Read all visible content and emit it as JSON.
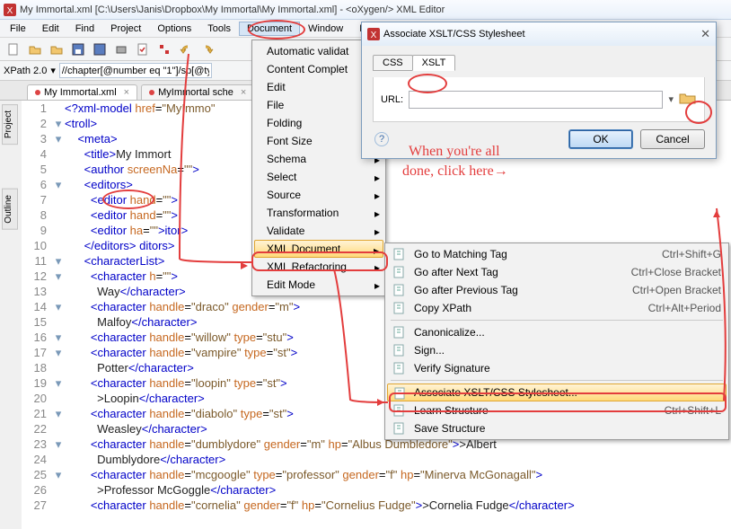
{
  "window_title": "My Immortal.xml [C:\\Users\\Janis\\Dropbox\\My Immortal\\My Immortal.xml] - <oXygen/> XML Editor",
  "menubar": [
    "File",
    "Edit",
    "Find",
    "Project",
    "Options",
    "Tools",
    "Document",
    "Window",
    "Help"
  ],
  "xpath": {
    "label": "XPath 2.0",
    "value": "//chapter[@number eq \"1\"]/sp[@typ"
  },
  "file_tabs": [
    {
      "label": "My Immortal.xml",
      "dirty": true
    },
    {
      "label": "MyImmortal sche",
      "dirty": true
    }
  ],
  "side_panels": [
    "Project",
    "Outline"
  ],
  "editor_lines": [
    {
      "n": 1,
      "f": "",
      "tag": "?xml-model",
      "attrs": [
        {
          "k": "href",
          "v": "MyImmo"
        }
      ],
      "text": "",
      "close": ""
    },
    {
      "n": 2,
      "f": "▾",
      "tag": "troll",
      "attrs": [],
      "text": "",
      "close": ""
    },
    {
      "n": 3,
      "f": "▾",
      "indent": 2,
      "tag": "meta",
      "attrs": [],
      "text": "",
      "close": ""
    },
    {
      "n": 4,
      "f": "",
      "indent": 3,
      "tag": "title",
      "attrs": [],
      "text": "My Immort",
      "close": ""
    },
    {
      "n": 5,
      "f": "",
      "indent": 3,
      "tag": "author",
      "attrs": [
        {
          "k": "screenNa",
          "v": ""
        }
      ],
      "text": "",
      "close": ""
    },
    {
      "n": 6,
      "f": "▾",
      "indent": 3,
      "tag": "editors",
      "attrs": [],
      "text": "",
      "close": ""
    },
    {
      "n": 7,
      "f": "",
      "indent": 4,
      "tag": "editor",
      "attrs": [
        {
          "k": "hand",
          "v": ""
        }
      ],
      "text": "",
      "close": ""
    },
    {
      "n": 8,
      "f": "",
      "indent": 4,
      "tag": "editor",
      "attrs": [
        {
          "k": "hand",
          "v": ""
        }
      ],
      "text": "",
      "close": ""
    },
    {
      "n": 9,
      "f": "",
      "indent": 4,
      "tag": "editor",
      "attrs": [
        {
          "k": "ha",
          "v": ""
        }
      ],
      "text": "",
      "close": "",
      "trail": "itor>"
    },
    {
      "n": 10,
      "f": "",
      "indent": 3,
      "closetag": "editors",
      "trail": "ditors>"
    },
    {
      "n": 11,
      "f": "▾",
      "indent": 3,
      "tag": "characterList",
      "attrs": [],
      "text": "",
      "close": ""
    },
    {
      "n": 12,
      "f": "▾",
      "indent": 4,
      "tag": "character",
      "attrs": [
        {
          "k": "h",
          "v": ""
        }
      ],
      "text": "",
      "close": ""
    },
    {
      "n": 13,
      "f": "",
      "indent": 5,
      "text": "Way",
      "closetag": "character"
    },
    {
      "n": 14,
      "f": "▾",
      "indent": 4,
      "tag": "character",
      "attrs": [
        {
          "k": "handle",
          "v": "draco"
        },
        {
          "k": "gender",
          "v": "m"
        }
      ],
      "text": "",
      "close": ""
    },
    {
      "n": 15,
      "f": "",
      "indent": 5,
      "text": "Malfoy",
      "closetag": "character"
    },
    {
      "n": 16,
      "f": "▾",
      "indent": 4,
      "tag": "character",
      "attrs": [
        {
          "k": "handle",
          "v": "willow"
        },
        {
          "k": "type",
          "v": "stu"
        }
      ],
      "text": "",
      "close": ""
    },
    {
      "n": 17,
      "f": "▾",
      "indent": 4,
      "tag": "character",
      "attrs": [
        {
          "k": "handle",
          "v": "vampire"
        },
        {
          "k": "type",
          "v": "st"
        }
      ],
      "text": "",
      "close": ""
    },
    {
      "n": 18,
      "f": "",
      "indent": 5,
      "text": "Potter",
      "closetag": "character"
    },
    {
      "n": 19,
      "f": "▾",
      "indent": 4,
      "tag": "character",
      "attrs": [
        {
          "k": "handle",
          "v": "loopin"
        },
        {
          "k": "type",
          "v": "st"
        }
      ],
      "text": "",
      "close": ""
    },
    {
      "n": 20,
      "f": "",
      "indent": 5,
      "text": ">Loopin",
      "closetag": "character"
    },
    {
      "n": 21,
      "f": "▾",
      "indent": 4,
      "tag": "character",
      "attrs": [
        {
          "k": "handle",
          "v": "diabolo"
        },
        {
          "k": "type",
          "v": "st"
        }
      ],
      "text": "",
      "close": ""
    },
    {
      "n": 22,
      "f": "",
      "indent": 5,
      "text": "Weasley",
      "closetag": "character"
    },
    {
      "n": 23,
      "f": "▾",
      "indent": 4,
      "tag": "character",
      "attrs": [
        {
          "k": "handle",
          "v": "dumblydore"
        },
        {
          "k": "gender",
          "v": "m"
        },
        {
          "k": "hp",
          "v": "Albus Dumbledore"
        }
      ],
      "text": ">Albert",
      "close": ""
    },
    {
      "n": 24,
      "f": "",
      "indent": 5,
      "text": "Dumblydore",
      "closetag": "character"
    },
    {
      "n": 25,
      "f": "▾",
      "indent": 4,
      "tag": "character",
      "attrs": [
        {
          "k": "handle",
          "v": "mcgoogle"
        },
        {
          "k": "type",
          "v": "professor"
        },
        {
          "k": "gender",
          "v": "f"
        },
        {
          "k": "hp",
          "v": "Minerva McGonagall"
        }
      ],
      "text": "",
      "close": ""
    },
    {
      "n": 26,
      "f": "",
      "indent": 5,
      "text": ">Professor McGoggle",
      "closetag": "character"
    },
    {
      "n": 27,
      "f": "",
      "indent": 4,
      "tag": "character",
      "attrs": [
        {
          "k": "handle",
          "v": "cornelia"
        },
        {
          "k": "gender",
          "v": "f"
        },
        {
          "k": "hp",
          "v": "Cornelius Fudge"
        }
      ],
      "text": ">Cornelia Fudge",
      "closetag": "character"
    }
  ],
  "doc_menu": [
    "Automatic validat",
    "Content Complet",
    "Edit",
    "File",
    "Folding",
    "Font Size",
    "Schema",
    "Select",
    "Source",
    "Transformation",
    "Validate",
    "XML Document",
    "XML Refactoring",
    "Edit Mode"
  ],
  "doc_menu_highlight": "XML Document",
  "xml_submenu": [
    {
      "l": "Go to Matching Tag",
      "s": "Ctrl+Shift+G"
    },
    {
      "l": "Go after Next Tag",
      "s": "Ctrl+Close Bracket"
    },
    {
      "l": "Go after Previous Tag",
      "s": "Ctrl+Open Bracket"
    },
    {
      "l": "Copy XPath",
      "s": "Ctrl+Alt+Period"
    },
    {
      "l": "Canonicalize...",
      "s": ""
    },
    {
      "l": "Sign...",
      "s": ""
    },
    {
      "l": "Verify Signature",
      "s": ""
    },
    {
      "l": "Associate XSLT/CSS Stylesheet...",
      "s": ""
    },
    {
      "l": "Learn Structure",
      "s": "Ctrl+Shift+L"
    },
    {
      "l": "Save Structure",
      "s": ""
    }
  ],
  "dialog": {
    "title": "Associate XSLT/CSS Stylesheet",
    "tabs": [
      "CSS",
      "XSLT"
    ],
    "active_tab": "XSLT",
    "url_label": "URL:",
    "url_value": "",
    "ok": "OK",
    "cancel": "Cancel"
  },
  "annotations": {
    "text1": "When you're all",
    "text2": "done, click here→"
  }
}
